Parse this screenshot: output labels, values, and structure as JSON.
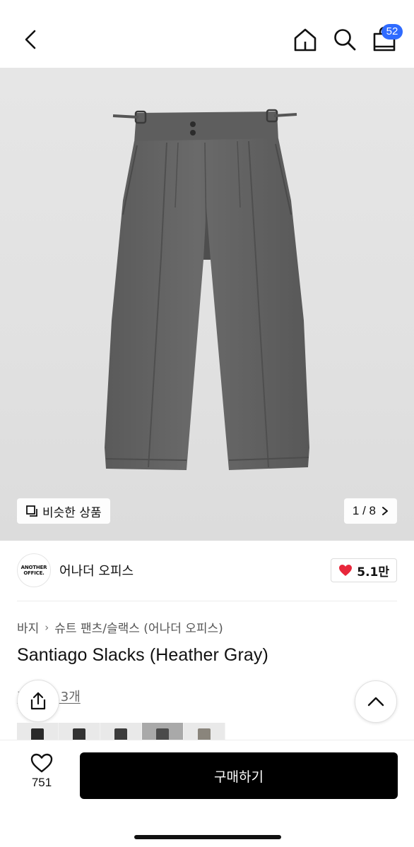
{
  "header": {
    "back_icon": "chevron-left-icon",
    "home_icon": "home-icon",
    "search_icon": "search-icon",
    "cart_icon": "shopping-bag-icon",
    "cart_count": "52",
    "badge_color": "#2f6bff"
  },
  "gallery": {
    "similar_label": "비슷한 상품",
    "page_indicator": "1 / 8",
    "image_alt_icon": "product-photo"
  },
  "brand": {
    "logo_line1": "ANOTHER",
    "logo_line2": "OFFICE.",
    "name": "어나더 오피스",
    "like_count": "5.1만",
    "like_color": "#e8273b"
  },
  "breadcrumb": {
    "items": [
      "바지",
      "슈트 팬츠/슬랙스 (어나더 오피스)"
    ]
  },
  "product": {
    "title": "Santiago Slacks (Heather Gray)",
    "review_text": "후기 113개"
  },
  "bottom": {
    "wish_count": "751",
    "buy_label": "구매하기"
  }
}
